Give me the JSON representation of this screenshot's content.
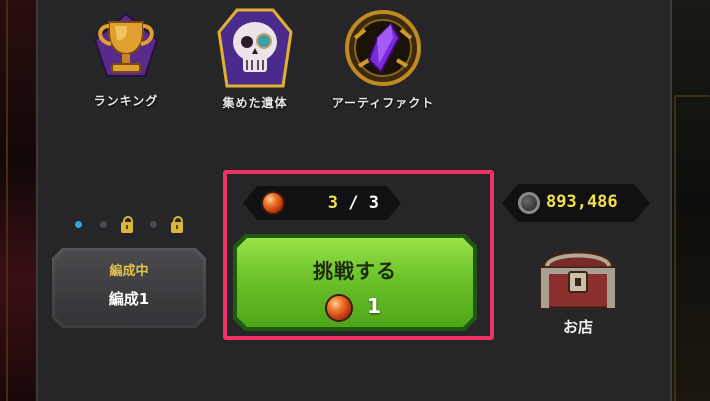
{
  "menu": {
    "ranking": {
      "label": "ランキング",
      "icon": "trophy-icon"
    },
    "relics": {
      "label": "集めた遺体",
      "icon": "skull-icon"
    },
    "artifact": {
      "label": "アーティファクト",
      "icon": "purple-gem-icon"
    }
  },
  "formation": {
    "pages": [
      "active",
      "empty",
      "locked",
      "empty",
      "locked"
    ],
    "status": "編成中",
    "name": "編成1"
  },
  "stamina": {
    "current": "3",
    "separator": "/",
    "max": "3"
  },
  "challenge": {
    "label": "挑戦する",
    "cost": "1"
  },
  "currency": {
    "value": "893,486"
  },
  "shop": {
    "label": "お店",
    "icon": "treasure-chest-icon"
  },
  "colors": {
    "highlight": "#f0326a",
    "button_green": "#6cc22a",
    "accent_yellow": "#f2e04a",
    "dot_active": "#2aa6e8"
  }
}
